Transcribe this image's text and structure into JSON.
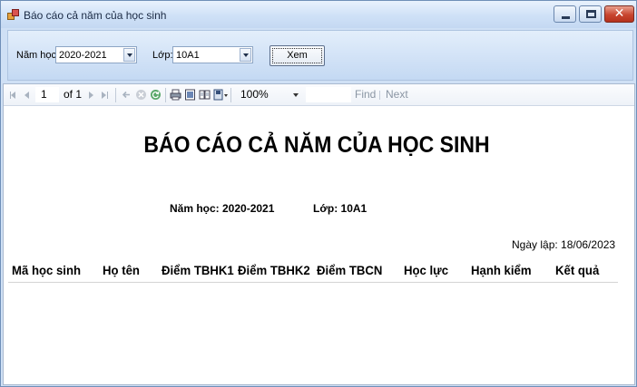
{
  "window": {
    "title": "Báo cáo cả năm của học sinh",
    "close_glyph": "✕"
  },
  "filters": {
    "year_label": "Năm học:",
    "year_value": "2020-2021",
    "class_label": "Lớp:",
    "class_value": "10A1",
    "view_button": "Xem"
  },
  "toolbar": {
    "page_current": "1",
    "page_of": "of 1",
    "zoom": "100%",
    "find": "Find",
    "next": "Next",
    "icons": [
      "first-page-icon",
      "prev-page-icon",
      "next-page-icon",
      "last-page-icon",
      "back-icon",
      "stop-icon",
      "refresh-icon",
      "print-icon",
      "print-layout-icon",
      "page-setup-icon",
      "export-icon"
    ]
  },
  "report": {
    "title": "BÁO CÁO CẢ NĂM CỦA HỌC SINH",
    "year_info": "Năm học: 2020-2021",
    "class_info": "Lớp: 10A1",
    "created_date": "Ngày lập: 18/06/2023",
    "columns": [
      "Mã học sinh",
      "Họ tên",
      "Điểm TBHK1",
      "Điểm TBHK2",
      "Điểm TBCN",
      "Học lực",
      "Hạnh kiểm",
      "Kết quả"
    ],
    "rows": []
  }
}
